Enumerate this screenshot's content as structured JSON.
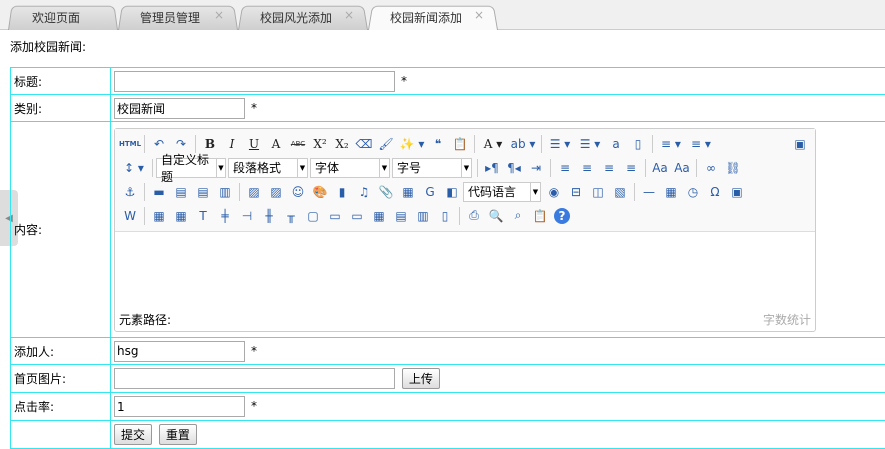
{
  "tabs": [
    {
      "label": "欢迎页面",
      "closable": false
    },
    {
      "label": "管理员管理",
      "closable": true
    },
    {
      "label": "校园风光添加",
      "closable": true
    },
    {
      "label": "校园新闻添加",
      "closable": true,
      "active": true
    }
  ],
  "page_title": "添加校园新闻:",
  "form": {
    "title": {
      "label": "标题:",
      "value": "",
      "required": "*"
    },
    "category": {
      "label": "类别:",
      "value": "校园新闻",
      "required": "*"
    },
    "content": {
      "label": "内容:",
      "element_path": "元素路径:",
      "word_count": "字数统计"
    },
    "author": {
      "label": "添加人:",
      "value": "hsg",
      "required": "*"
    },
    "image": {
      "label": "首页图片:",
      "value": "",
      "upload": "上传"
    },
    "clicks": {
      "label": "点击率:",
      "value": "1",
      "required": "*"
    },
    "submit": "提交",
    "reset": "重置"
  },
  "toolbar": [
    [
      "html",
      "|",
      "undo",
      "redo",
      "|",
      "bold",
      "italic",
      "underline",
      "fontborder",
      "strikethrough",
      "superscript",
      "subscript",
      "eraser",
      "formatmatch",
      "autotypeset+",
      "blockquote",
      "pasteplain",
      "|",
      "forecolor+",
      "backcolor+",
      "|",
      "orderedlist+",
      "unorderedlist+",
      "selectall",
      "cleardoc",
      "|",
      "rowspacingtop+",
      "rowspacingbottom+",
      "_",
      "preview"
    ],
    [
      "lineheight+",
      "|",
      "sel:自定义标题:70",
      "sel:段落格式:80",
      "sel:字体:80",
      "sel:字号:80",
      "|",
      "ltr",
      "rtl",
      "indent",
      "|",
      "justifyleft",
      "justifycenter",
      "justifyright",
      "justifyjustify",
      "|",
      "touppercase",
      "tolowercase",
      "|",
      "link",
      "unlink"
    ],
    [
      "anchor",
      "|",
      "imagenone",
      "imageleft",
      "imageright",
      "imagecenter",
      "|",
      "image",
      "multiimage",
      "emotion",
      "scrawl",
      "video",
      "music",
      "attachment",
      "map",
      "gmap",
      "frame",
      "sel:代码语言:78",
      "webapp",
      "pagebreak",
      "template",
      "background",
      "|",
      "horizontal",
      "date",
      "time",
      "spechars",
      "snapscreen"
    ],
    [
      "wordimage",
      "|",
      "inserttable",
      "deletetable",
      "insertparagraph",
      "insertrow",
      "deleterow",
      "insertcol",
      "deletecol",
      "mergecells",
      "mergeright",
      "mergedown",
      "splittocells",
      "splittorows",
      "splittocols",
      "charts",
      "|",
      "print",
      "searchreplace",
      "searchfind",
      "drafts",
      "help"
    ]
  ]
}
